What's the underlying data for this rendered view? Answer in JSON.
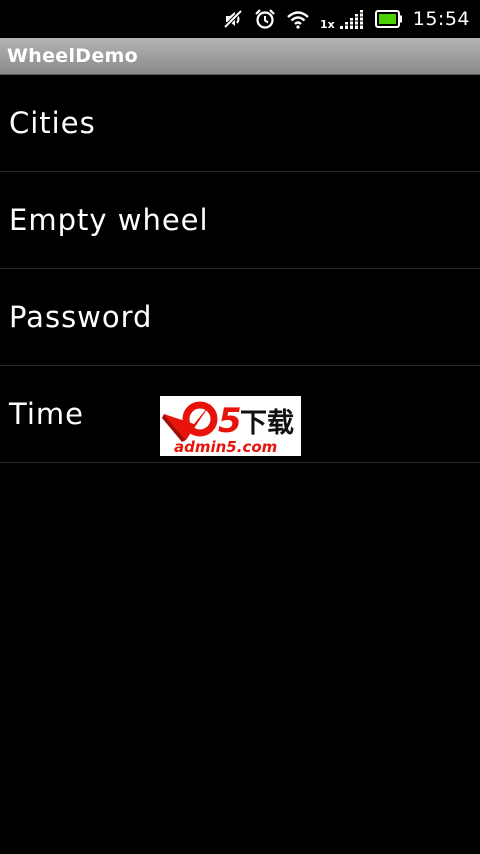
{
  "status_bar": {
    "network_type": "1x",
    "time": "15:54",
    "icons": [
      "mute-icon",
      "alarm-icon",
      "wifi-icon",
      "signal-icon",
      "battery-icon"
    ],
    "battery_color": "#4cd000"
  },
  "app": {
    "title": "WheelDemo"
  },
  "list": {
    "items": [
      {
        "label": "Cities"
      },
      {
        "label": "Empty wheel"
      },
      {
        "label": "Password"
      },
      {
        "label": "Time"
      }
    ]
  },
  "watermark": {
    "logo_text": "a5下载",
    "site_text": "admin5.com"
  }
}
